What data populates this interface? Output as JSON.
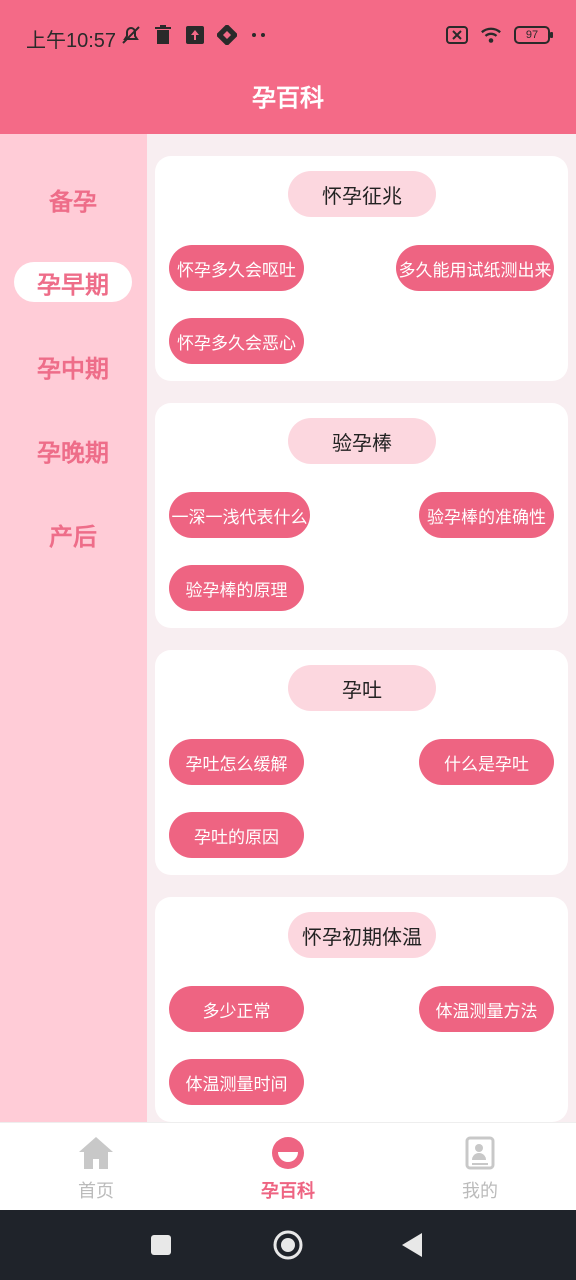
{
  "status": {
    "time": "上午10:57",
    "battery": "97"
  },
  "header": {
    "title": "孕百科"
  },
  "sidebar": {
    "items": [
      {
        "label": "备孕"
      },
      {
        "label": "孕早期"
      },
      {
        "label": "孕中期"
      },
      {
        "label": "孕晚期"
      },
      {
        "label": "产后"
      }
    ],
    "active_index": 1
  },
  "cards": [
    {
      "title": "怀孕征兆",
      "topics": [
        "怀孕多久会呕吐",
        "多久能用试纸测出来",
        "怀孕多久会恶心"
      ]
    },
    {
      "title": "验孕棒",
      "topics": [
        "一深一浅代表什么",
        "验孕棒的准确性",
        "验孕棒的原理"
      ]
    },
    {
      "title": "孕吐",
      "topics": [
        "孕吐怎么缓解",
        "什么是孕吐",
        "孕吐的原因"
      ]
    },
    {
      "title": "怀孕初期体温",
      "topics": [
        "多少正常",
        "体温测量方法",
        "体温测量时间"
      ]
    }
  ],
  "bottom_nav": {
    "items": [
      {
        "label": "首页",
        "icon": "home-icon"
      },
      {
        "label": "孕百科",
        "icon": "encyclopedia-icon"
      },
      {
        "label": "我的",
        "icon": "profile-book-icon"
      }
    ],
    "active_index": 1
  },
  "colors": {
    "accent": "#f46a87",
    "pill": "#ee6482",
    "pill_light": "#fcd7df",
    "sidebar_bg": "#ffccd7"
  }
}
